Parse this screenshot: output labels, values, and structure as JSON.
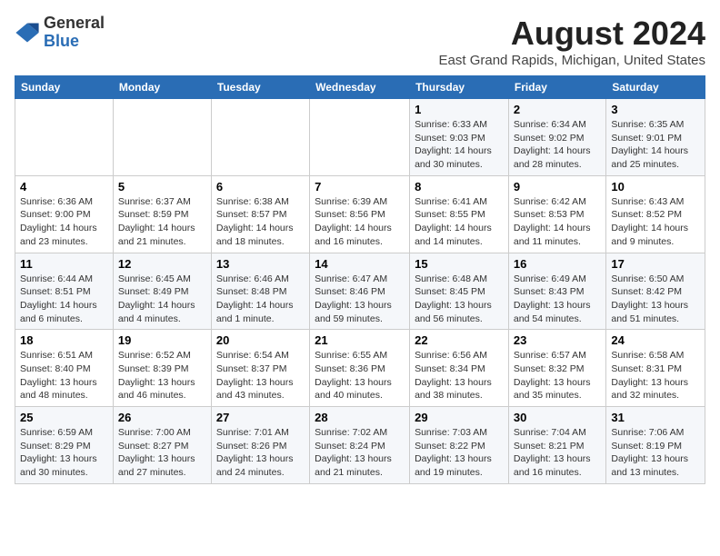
{
  "header": {
    "logo": {
      "line1": "General",
      "line2": "Blue"
    },
    "title": "August 2024",
    "subtitle": "East Grand Rapids, Michigan, United States"
  },
  "days_of_week": [
    "Sunday",
    "Monday",
    "Tuesday",
    "Wednesday",
    "Thursday",
    "Friday",
    "Saturday"
  ],
  "weeks": [
    [
      {
        "day": "",
        "info": ""
      },
      {
        "day": "",
        "info": ""
      },
      {
        "day": "",
        "info": ""
      },
      {
        "day": "",
        "info": ""
      },
      {
        "day": "1",
        "info": "Sunrise: 6:33 AM\nSunset: 9:03 PM\nDaylight: 14 hours and 30 minutes."
      },
      {
        "day": "2",
        "info": "Sunrise: 6:34 AM\nSunset: 9:02 PM\nDaylight: 14 hours and 28 minutes."
      },
      {
        "day": "3",
        "info": "Sunrise: 6:35 AM\nSunset: 9:01 PM\nDaylight: 14 hours and 25 minutes."
      }
    ],
    [
      {
        "day": "4",
        "info": "Sunrise: 6:36 AM\nSunset: 9:00 PM\nDaylight: 14 hours and 23 minutes."
      },
      {
        "day": "5",
        "info": "Sunrise: 6:37 AM\nSunset: 8:59 PM\nDaylight: 14 hours and 21 minutes."
      },
      {
        "day": "6",
        "info": "Sunrise: 6:38 AM\nSunset: 8:57 PM\nDaylight: 14 hours and 18 minutes."
      },
      {
        "day": "7",
        "info": "Sunrise: 6:39 AM\nSunset: 8:56 PM\nDaylight: 14 hours and 16 minutes."
      },
      {
        "day": "8",
        "info": "Sunrise: 6:41 AM\nSunset: 8:55 PM\nDaylight: 14 hours and 14 minutes."
      },
      {
        "day": "9",
        "info": "Sunrise: 6:42 AM\nSunset: 8:53 PM\nDaylight: 14 hours and 11 minutes."
      },
      {
        "day": "10",
        "info": "Sunrise: 6:43 AM\nSunset: 8:52 PM\nDaylight: 14 hours and 9 minutes."
      }
    ],
    [
      {
        "day": "11",
        "info": "Sunrise: 6:44 AM\nSunset: 8:51 PM\nDaylight: 14 hours and 6 minutes."
      },
      {
        "day": "12",
        "info": "Sunrise: 6:45 AM\nSunset: 8:49 PM\nDaylight: 14 hours and 4 minutes."
      },
      {
        "day": "13",
        "info": "Sunrise: 6:46 AM\nSunset: 8:48 PM\nDaylight: 14 hours and 1 minute."
      },
      {
        "day": "14",
        "info": "Sunrise: 6:47 AM\nSunset: 8:46 PM\nDaylight: 13 hours and 59 minutes."
      },
      {
        "day": "15",
        "info": "Sunrise: 6:48 AM\nSunset: 8:45 PM\nDaylight: 13 hours and 56 minutes."
      },
      {
        "day": "16",
        "info": "Sunrise: 6:49 AM\nSunset: 8:43 PM\nDaylight: 13 hours and 54 minutes."
      },
      {
        "day": "17",
        "info": "Sunrise: 6:50 AM\nSunset: 8:42 PM\nDaylight: 13 hours and 51 minutes."
      }
    ],
    [
      {
        "day": "18",
        "info": "Sunrise: 6:51 AM\nSunset: 8:40 PM\nDaylight: 13 hours and 48 minutes."
      },
      {
        "day": "19",
        "info": "Sunrise: 6:52 AM\nSunset: 8:39 PM\nDaylight: 13 hours and 46 minutes."
      },
      {
        "day": "20",
        "info": "Sunrise: 6:54 AM\nSunset: 8:37 PM\nDaylight: 13 hours and 43 minutes."
      },
      {
        "day": "21",
        "info": "Sunrise: 6:55 AM\nSunset: 8:36 PM\nDaylight: 13 hours and 40 minutes."
      },
      {
        "day": "22",
        "info": "Sunrise: 6:56 AM\nSunset: 8:34 PM\nDaylight: 13 hours and 38 minutes."
      },
      {
        "day": "23",
        "info": "Sunrise: 6:57 AM\nSunset: 8:32 PM\nDaylight: 13 hours and 35 minutes."
      },
      {
        "day": "24",
        "info": "Sunrise: 6:58 AM\nSunset: 8:31 PM\nDaylight: 13 hours and 32 minutes."
      }
    ],
    [
      {
        "day": "25",
        "info": "Sunrise: 6:59 AM\nSunset: 8:29 PM\nDaylight: 13 hours and 30 minutes."
      },
      {
        "day": "26",
        "info": "Sunrise: 7:00 AM\nSunset: 8:27 PM\nDaylight: 13 hours and 27 minutes."
      },
      {
        "day": "27",
        "info": "Sunrise: 7:01 AM\nSunset: 8:26 PM\nDaylight: 13 hours and 24 minutes."
      },
      {
        "day": "28",
        "info": "Sunrise: 7:02 AM\nSunset: 8:24 PM\nDaylight: 13 hours and 21 minutes."
      },
      {
        "day": "29",
        "info": "Sunrise: 7:03 AM\nSunset: 8:22 PM\nDaylight: 13 hours and 19 minutes."
      },
      {
        "day": "30",
        "info": "Sunrise: 7:04 AM\nSunset: 8:21 PM\nDaylight: 13 hours and 16 minutes."
      },
      {
        "day": "31",
        "info": "Sunrise: 7:06 AM\nSunset: 8:19 PM\nDaylight: 13 hours and 13 minutes."
      }
    ]
  ]
}
